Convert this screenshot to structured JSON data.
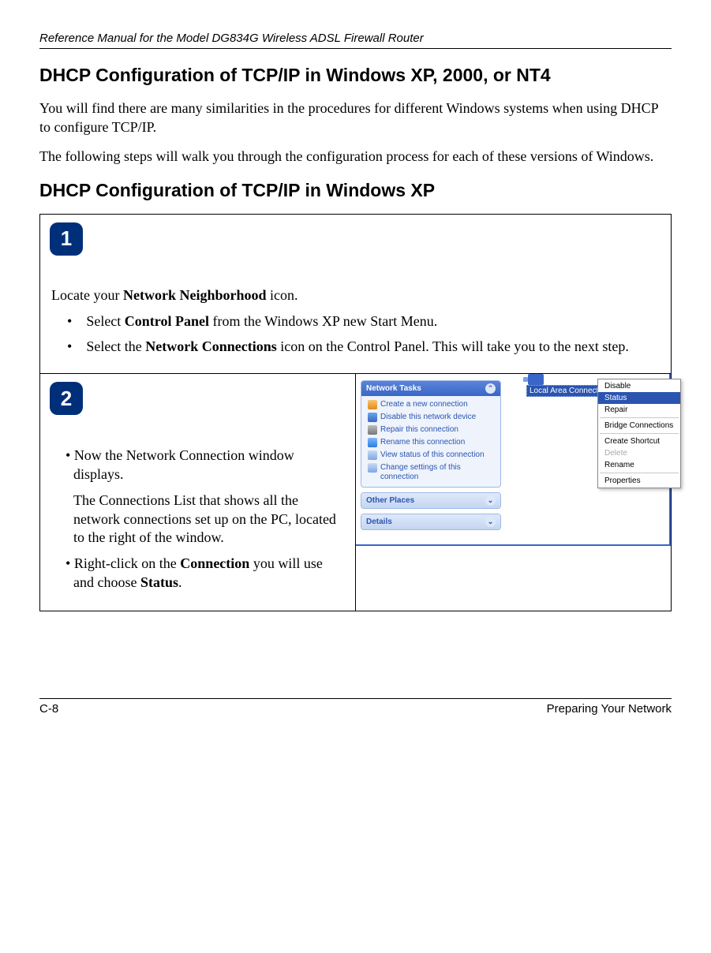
{
  "header": {
    "running_title": "Reference Manual for the Model DG834G Wireless ADSL Firewall Router"
  },
  "h1": "DHCP Configuration of TCP/IP in Windows XP, 2000, or NT4",
  "p1": "You will find there are many similarities in the procedures for different Windows systems when using DHCP to configure TCP/IP.",
  "p2": "The following steps will walk you through the configuration process for each of these versions of Windows.",
  "h2": "DHCP Configuration of TCP/IP in Windows XP",
  "step1": {
    "num": "1",
    "intro_pre": "Locate your ",
    "intro_bold": "Network Neighborhood",
    "intro_post": " icon.",
    "b1_pre": "Select ",
    "b1_bold": "Control Panel",
    "b1_post": " from the Windows XP new Start Menu.",
    "b2_pre": "Select the ",
    "b2_bold": "Network Connections",
    "b2_post": " icon on the Control Panel.  This will take you to the next step."
  },
  "step2": {
    "num": "2",
    "l1": "Now the Network Connection window displays.",
    "l1_para": "The Connections List that shows all the network connections set up on the PC, located to the right of the window.",
    "l2_pre": "Right-click on the ",
    "l2_bold1": "Connection",
    "l2_mid": " you will use and choose ",
    "l2_bold2": "Status",
    "l2_post": "."
  },
  "screenshot": {
    "panel_title": "Network Tasks",
    "tasks": {
      "create": "Create a new connection",
      "disable": "Disable this network device",
      "repair": "Repair this connection",
      "rename": "Rename this connection",
      "view": "View status of this connection",
      "change": "Change settings of this connection"
    },
    "other_places": "Other Places",
    "details": "Details",
    "lac_label": "Local Area Connection",
    "menu": {
      "disable": "Disable",
      "status": "Status",
      "repair": "Repair",
      "bridge": "Bridge Connections",
      "shortcut": "Create Shortcut",
      "delete": "Delete",
      "rename": "Rename",
      "properties": "Properties"
    }
  },
  "footer": {
    "left": "C-8",
    "right": "Preparing Your Network"
  }
}
